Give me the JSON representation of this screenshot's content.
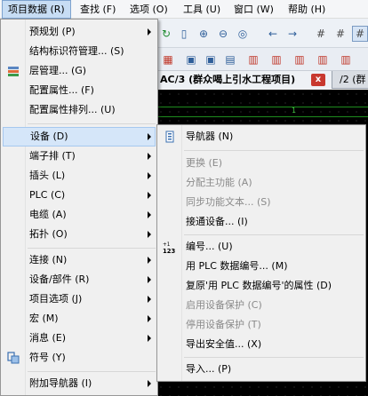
{
  "menubar": {
    "items": [
      "项目数据 (R)",
      "查找 (F)",
      "选项 (O)",
      "工具 (U)",
      "窗口 (W)",
      "帮助 (H)"
    ]
  },
  "document": {
    "tab_title": "AC/3 (群众喝上引水工程项目)",
    "tab_close": "x",
    "second_tab": "/2 (群",
    "ruler_label": "1"
  },
  "project_menu": {
    "items": [
      {
        "label": "预规划 (P)",
        "submenu": true
      },
      {
        "label": "结构标识符管理... (S)",
        "submenu": false
      },
      {
        "label": "层管理... (G)",
        "submenu": false
      },
      {
        "label": "配置属性... (F)",
        "submenu": false
      },
      {
        "label": "配置属性排列... (U)",
        "submenu": false
      },
      {
        "label": "设备 (D)",
        "submenu": true
      },
      {
        "label": "端子排 (T)",
        "submenu": true
      },
      {
        "label": "插头 (L)",
        "submenu": true
      },
      {
        "label": "PLC (C)",
        "submenu": true
      },
      {
        "label": "电缆 (A)",
        "submenu": true
      },
      {
        "label": "拓扑 (O)",
        "submenu": true
      },
      {
        "label": "连接 (N)",
        "submenu": true
      },
      {
        "label": "设备/部件 (R)",
        "submenu": true
      },
      {
        "label": "项目选项 (J)",
        "submenu": true
      },
      {
        "label": "宏 (M)",
        "submenu": true
      },
      {
        "label": "消息 (E)",
        "submenu": true
      },
      {
        "label": "符号 (Y)",
        "submenu": false
      },
      {
        "label": "附加导航器 (I)",
        "submenu": true
      }
    ]
  },
  "device_submenu": {
    "items": [
      {
        "label": "导航器 (N)",
        "enabled": true
      },
      {
        "label": "更换 (E)",
        "enabled": false
      },
      {
        "label": "分配主功能 (A)",
        "enabled": false
      },
      {
        "label": "同步功能文本... (S)",
        "enabled": false
      },
      {
        "label": "接通设备... (I)",
        "enabled": true
      },
      {
        "label": "编号... (U)",
        "enabled": true
      },
      {
        "label": "用 PLC 数据编号... (M)",
        "enabled": true
      },
      {
        "label": "复原'用 PLC 数据编号'的属性 (D)",
        "enabled": true
      },
      {
        "label": "启用设备保护 (C)",
        "enabled": false
      },
      {
        "label": "停用设备保护 (T)",
        "enabled": false
      },
      {
        "label": "导出安全值... (X)",
        "enabled": true
      },
      {
        "label": "导入... (P)",
        "enabled": true
      }
    ]
  }
}
